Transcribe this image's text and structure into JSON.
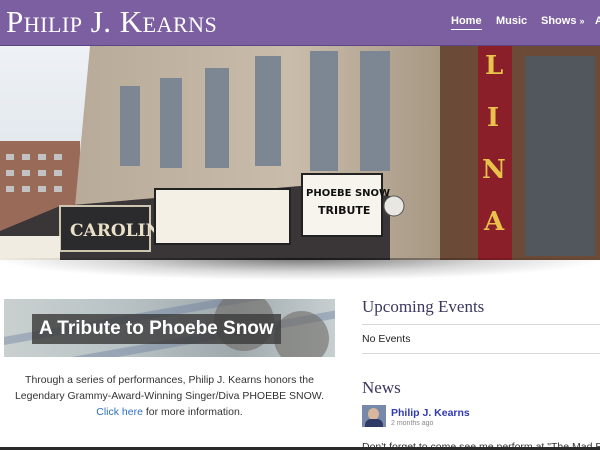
{
  "site": {
    "title": "Philip J. Kearns"
  },
  "nav": {
    "home": "Home",
    "music": "Music",
    "shows": "Shows",
    "shows_chevron": "»",
    "more_partial": "A"
  },
  "hero": {
    "marquee_left": "CAROLINA",
    "marquee_sign_line1": "PHOEBE SNOW",
    "marquee_sign_line2": "TRIBUTE",
    "vertical_sign": "LINA"
  },
  "tribute": {
    "banner_title": "A Tribute to Phoebe Snow",
    "text_before_link": "Through a series of performances, Philip J. Kearns honors the Legendary Grammy-Award-Winning Singer/Diva PHOEBE SNOW.",
    "link_text": "Click here",
    "text_after_link": "for more information."
  },
  "sidebar": {
    "events_title": "Upcoming Events",
    "events_empty": "No Events",
    "news_title": "News",
    "news_author": "Philip J. Kearns",
    "news_time": "2 months ago",
    "news_snippet": "Don't forget to come see me perform at \"The Mad Bean"
  },
  "colors": {
    "header": "#7b5fa1",
    "link": "#2f6fbf",
    "author": "#2f3ab0",
    "section_title": "#3c3760"
  }
}
